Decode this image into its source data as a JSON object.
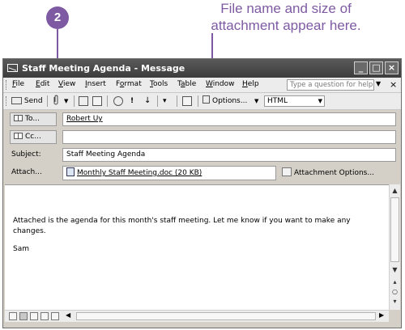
{
  "callout": {
    "number": "2",
    "text_line1": "File name and size of",
    "text_line2": "attachment appear here."
  },
  "window": {
    "title": "Staff Meeting Agenda - Message",
    "controls": {
      "minimize": "_",
      "maximize": "□",
      "close": "×"
    }
  },
  "menu": {
    "items": [
      {
        "label": "File",
        "key": "F",
        "rest": "ile"
      },
      {
        "label": "Edit",
        "key": "E",
        "rest": "dit"
      },
      {
        "label": "View",
        "key": "V",
        "rest": "iew"
      },
      {
        "label": "Insert",
        "key": "I",
        "rest": "nsert"
      },
      {
        "label": "Format",
        "key": "o",
        "pre": "F",
        "rest": "rmat"
      },
      {
        "label": "Tools",
        "key": "T",
        "rest": "ools"
      },
      {
        "label": "Table",
        "key": "a",
        "pre": "T",
        "rest": "ble"
      },
      {
        "label": "Window",
        "key": "W",
        "rest": "indow"
      },
      {
        "label": "Help",
        "key": "H",
        "rest": "elp"
      }
    ],
    "help_placeholder": "Type a question for help"
  },
  "toolbar": {
    "send": "Send",
    "options": "Options...",
    "format": "HTML"
  },
  "fields": {
    "to_label": "To...",
    "to_value": "Robert Uy",
    "cc_label": "Cc...",
    "cc_value": "",
    "subject_label": "Subject:",
    "subject_value": "Staff Meeting Agenda",
    "attach_label": "Attach...",
    "attach_value": "Monthly Staff Meeting.doc (20 KB)",
    "attach_options": "Attachment Options..."
  },
  "message": {
    "line1": "Attached is the agenda for this month's staff meeting. Let me know if you want to make any changes.",
    "signature": "Sam"
  },
  "colors": {
    "callout": "#7e5aa3",
    "titlebar": "#4a4a4a",
    "chrome": "#ececec"
  }
}
